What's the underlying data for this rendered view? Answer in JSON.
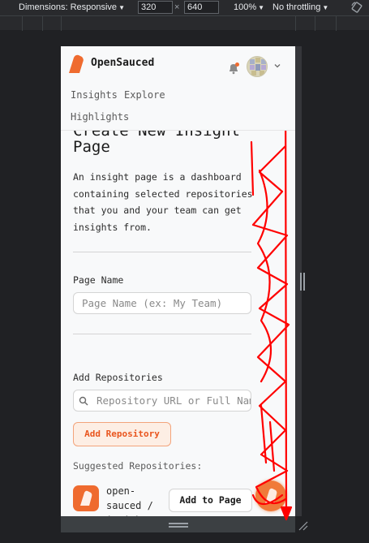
{
  "devtools": {
    "dimensions_label": "Dimensions: Responsive",
    "width_value": "320",
    "times_sign": "×",
    "height_value": "640",
    "zoom": "100%",
    "throttling": "No throttling"
  },
  "app": {
    "brand": "OpenSauced",
    "nav": [
      "Insights",
      "Explore",
      "Highlights"
    ]
  },
  "page": {
    "title": "Create New Insight Page",
    "description": "An insight page is a dashboard containing selected repositories that you and your team can get insights from.",
    "page_name_label": "Page Name",
    "page_name_placeholder": "Page Name (ex: My Team)",
    "add_repos_label": "Add Repositories",
    "repo_search_placeholder": "Repository URL or Full Name",
    "add_repo_button": "Add Repository",
    "suggested_label": "Suggested Repositories:",
    "suggested_repo": "open-sauced / insights",
    "add_to_page_button": "Add to Page"
  },
  "colors": {
    "brand_orange": "#ef6b2f",
    "annotation_red": "#ff0000"
  }
}
